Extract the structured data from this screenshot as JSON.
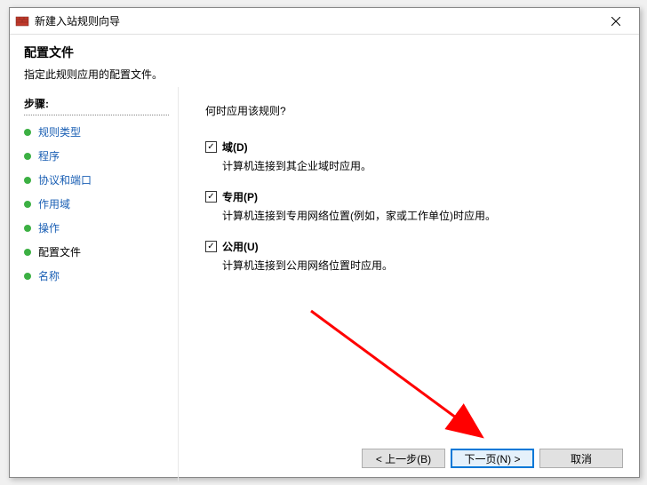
{
  "window": {
    "title": "新建入站规则向导"
  },
  "header": {
    "title": "配置文件",
    "desc": "指定此规则应用的配置文件。"
  },
  "sidebar": {
    "heading": "步骤:",
    "steps": [
      {
        "label": "规则类型"
      },
      {
        "label": "程序"
      },
      {
        "label": "协议和端口"
      },
      {
        "label": "作用域"
      },
      {
        "label": "操作"
      },
      {
        "label": "配置文件"
      },
      {
        "label": "名称"
      }
    ]
  },
  "content": {
    "question": "何时应用该规则?",
    "options": [
      {
        "label": "域(D)",
        "desc": "计算机连接到其企业域时应用。"
      },
      {
        "label": "专用(P)",
        "desc": "计算机连接到专用网络位置(例如，家或工作单位)时应用。"
      },
      {
        "label": "公用(U)",
        "desc": "计算机连接到公用网络位置时应用。"
      }
    ]
  },
  "footer": {
    "back": "< 上一步(B)",
    "next": "下一页(N) >",
    "cancel": "取消"
  }
}
